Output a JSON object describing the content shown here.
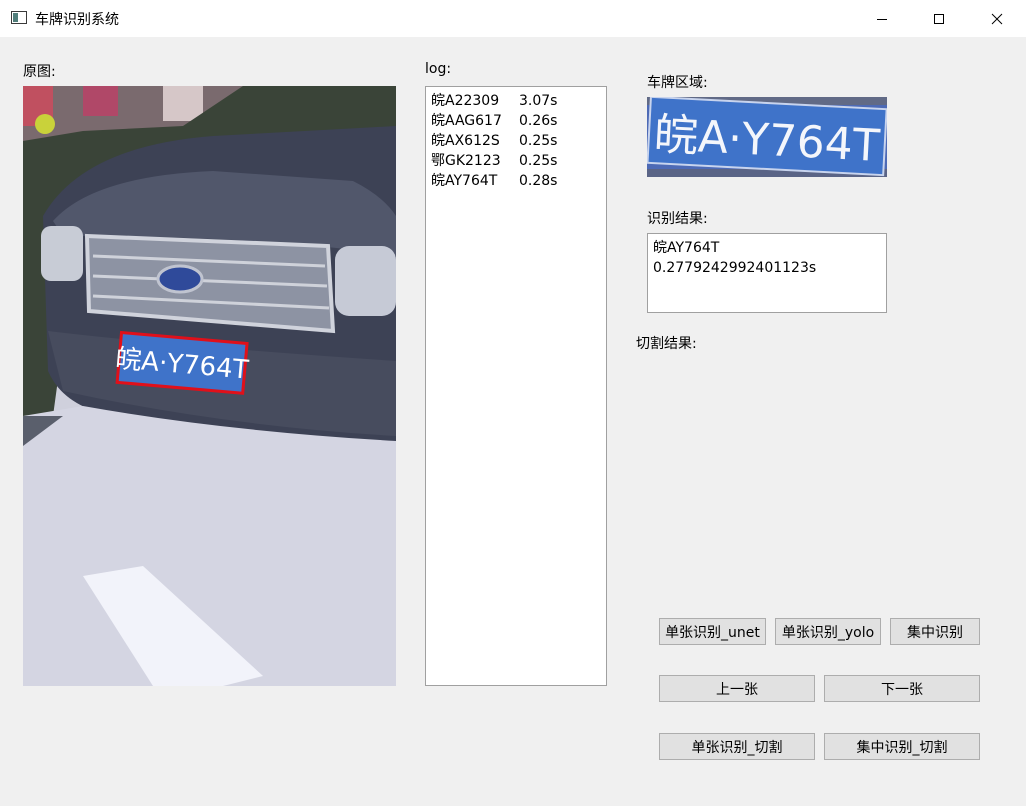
{
  "window": {
    "title": "车牌识别系统",
    "app_icon": "window-app-icon",
    "minimize_icon": "minimize-icon",
    "maximize_icon": "maximize-icon",
    "close_icon": "close-icon"
  },
  "labels": {
    "original": "原图:",
    "log": "log:",
    "plate_region": "车牌区域:",
    "result": "识别结果:",
    "segmentation": "切割结果:"
  },
  "log": [
    {
      "plate": "皖A22309",
      "time": "3.07s"
    },
    {
      "plate": "皖AAG617",
      "time": "0.26s"
    },
    {
      "plate": "皖AX612S",
      "time": "0.25s"
    },
    {
      "plate": "鄂GK2123",
      "time": "0.25s"
    },
    {
      "plate": "皖AY764T",
      "time": "0.28s"
    }
  ],
  "plate_text": "皖A·Y764T",
  "result": {
    "plate": "皖AY764T",
    "time": "0.2779242992401123s"
  },
  "buttons": {
    "single_unet": "单张识别_unet",
    "single_yolo": "单张识别_yolo",
    "batch": "集中识别",
    "prev": "上一张",
    "next": "下一张",
    "single_seg": "单张识别_切割",
    "batch_seg": "集中识别_切割"
  },
  "colors": {
    "plate_blue": "#3f73c9",
    "plate_outline": "#e0101a"
  }
}
